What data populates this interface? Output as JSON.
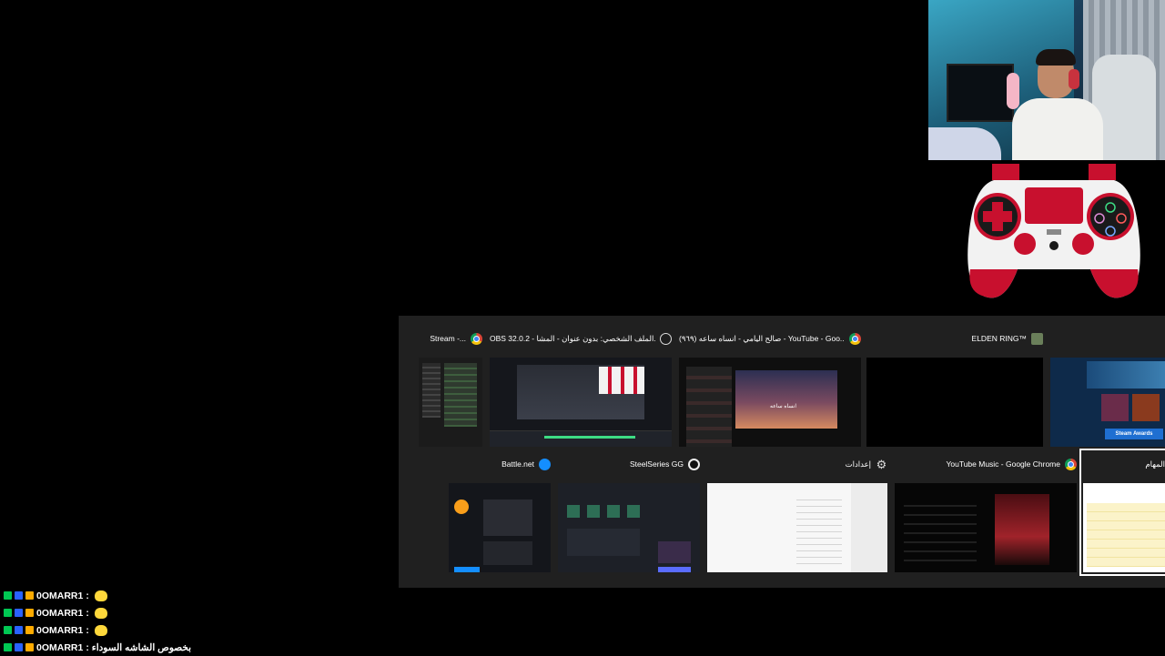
{
  "switcher": {
    "top_row": [
      {
        "title": "Stream -...",
        "icon": "chrome-icon"
      },
      {
        "title": "OBS 32.0.2 - الملف الشخصي: بدون عنوان - المشا...",
        "icon": "obs-icon"
      },
      {
        "title": "(٩٦٩) صالح اليامي - انساه ساعه - YouTube - Goo...",
        "icon": "chrome-icon"
      },
      {
        "title": "ELDEN RING™",
        "icon": "elden-ring-icon"
      },
      {
        "title": "",
        "icon": "steam-icon"
      }
    ],
    "bottom_row": [
      {
        "title": "Battle.net",
        "icon": "battlenet-icon"
      },
      {
        "title": "SteelSeries GG",
        "icon": "steelseries-icon"
      },
      {
        "title": "إعدادات",
        "icon": "gear-icon"
      },
      {
        "title": "YouTube Music - Google Chrome",
        "icon": "chrome-icon"
      },
      {
        "title": "المهام",
        "icon": "task-icon"
      }
    ],
    "thumb_texts": {
      "steam_awards": "Steam Awards",
      "video_title": "انساه ساعه"
    }
  },
  "chat": {
    "messages": [
      {
        "user": "0OMARR1",
        "text": ":"
      },
      {
        "user": "0OMARR1",
        "text": ":"
      },
      {
        "user": "0OMARR1",
        "text": ":"
      },
      {
        "user": "0OMARR1",
        "text": ": بخصوص الشاشه السوداء"
      }
    ]
  },
  "colors": {
    "switcher_bg": "#202020",
    "controller_red": "#c8102e",
    "badge_green": "#00c853",
    "badge_blue": "#2962ff",
    "badge_yellow": "#ffab00"
  }
}
